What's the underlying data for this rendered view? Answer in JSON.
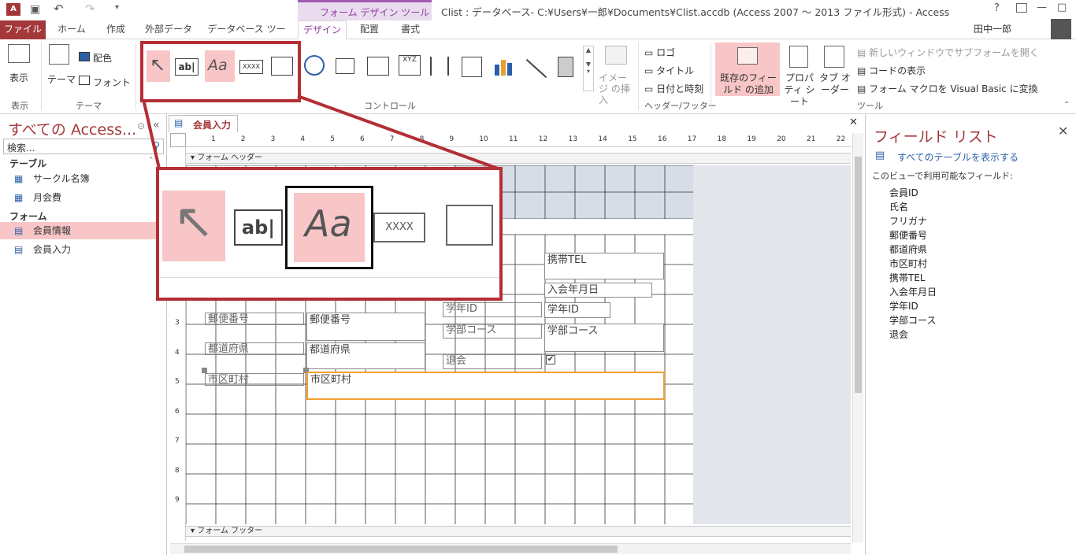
{
  "app": {
    "title": "Clist : データベース- C:¥Users¥一郎¥Documents¥Clist.accdb (Access 2007 ～ 2013 ファイル形式) - Access",
    "context_tab_title": "フォーム デザイン ツール",
    "user": "田中一郎",
    "help": "?",
    "window_buttons": [
      "—",
      "□",
      "✕"
    ]
  },
  "tabs": [
    "ファイル",
    "ホーム",
    "作成",
    "外部データ",
    "データベース ツール",
    "デザイン",
    "配置",
    "書式"
  ],
  "ribbon": {
    "view_group": {
      "button": "表示",
      "label": "表示"
    },
    "theme_group": {
      "theme": "テーマ",
      "colors": "配色",
      "fonts": "フォント",
      "label": "テーマ"
    },
    "controls_label": "コントロール",
    "image_insert": "イメージ の挿入",
    "header_footer": {
      "logo": "ロゴ",
      "title": "タイトル",
      "datetime": "日付と時刻",
      "label": "ヘッダー/フッター"
    },
    "tools": {
      "add_fields": "既存のフィールド の追加",
      "property_sheet": "プロパティ シート",
      "tab_order": "タブ オーダー",
      "open_subform": "新しいウィンドウでサブフォームを開く",
      "view_code": "コードの表示",
      "convert_macro": "フォーム マクロを Visual Basic に変換",
      "label": "ツール"
    }
  },
  "nav": {
    "header": "すべての Access...",
    "search_placeholder": "検索...",
    "sections": [
      {
        "name": "テーブル",
        "items": [
          "サークル名簿",
          "月会費"
        ]
      },
      {
        "name": "フォーム",
        "items": [
          "会員情報",
          "会員入力"
        ]
      }
    ]
  },
  "document": {
    "tab_label": "会員入力",
    "close": "✕",
    "header_section": "フォーム ヘッダー",
    "footer_section": "フォーム フッター",
    "ruler_numbers": [
      "1",
      "2",
      "3",
      "4",
      "5",
      "6",
      "7",
      "8",
      "9",
      "10",
      "11",
      "12",
      "13",
      "14",
      "15",
      "16",
      "17",
      "18",
      "19",
      "20",
      "21",
      "22"
    ],
    "vruler_numbers": [
      "3",
      "4",
      "5",
      "6",
      "7",
      "8",
      "9"
    ],
    "controls": {
      "mobile_tel": "携帯TEL",
      "join_date": "入会年月日",
      "student_id_label": "学年ID",
      "student_id": "学年ID",
      "faculty_label": "学部コース",
      "faculty": "学部コース",
      "withdraw_label": "退会",
      "postal_label": "郵便番号",
      "postal": "郵便番号",
      "pref_label": "都道府県",
      "pref": "都道府県",
      "city_label": "市区町村",
      "city": "市区町村",
      "checkmark": "✔"
    }
  },
  "field_list": {
    "title": "フィールド リスト",
    "show_all": "すべてのテーブルを表示する",
    "available": "このビューで利用可能なフィールド:",
    "fields": [
      "会員ID",
      "氏名",
      "フリガナ",
      "郵便番号",
      "都道府県",
      "市区町村",
      "携帯TEL",
      "入会年月日",
      "学年ID",
      "学部コース",
      "退会"
    ]
  },
  "zoom": {
    "textbox_icon": "ab|",
    "label_icon": "Aa",
    "button_icon": "XXXX",
    "xyz_icon": "XYZ"
  },
  "colors": {
    "accent": "#a4373a",
    "context": "#8c3d9c",
    "highlight": "#f8c6c7",
    "callout": "#b32e35",
    "selection": "#f0a030"
  }
}
